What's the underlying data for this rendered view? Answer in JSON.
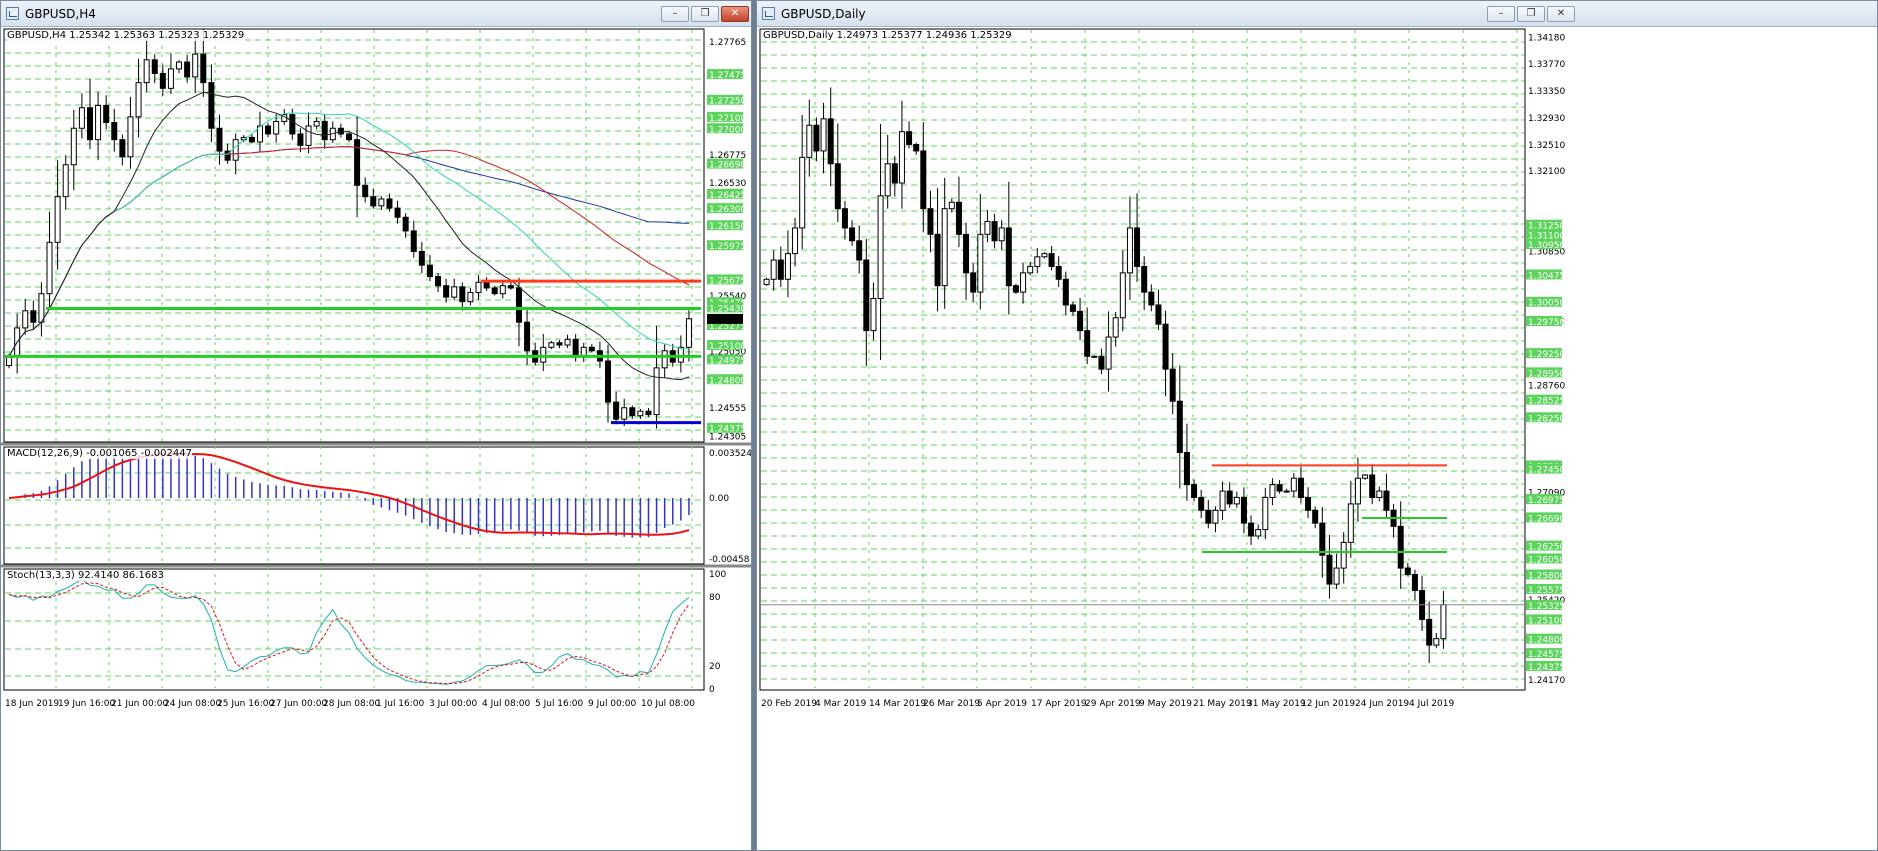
{
  "windowA": {
    "title": "GBPUSD,H4",
    "main_header": "GBPUSD,H4  1.25342 1.25363 1.25323 1.25329",
    "macd_header": "MACD(12,26,9) -0.001065 -0.002447",
    "stoch_header": "Stoch(13,3,3) 92.4140 86.1683",
    "price_labels": [
      "1.27765",
      "1.26775",
      "1.26530",
      "1.25540",
      "1.25050",
      "1.24555",
      "1.24305"
    ],
    "green_price_tags": [
      "1.27475",
      "1.27250",
      "1.27100",
      "1.27000",
      "1.26690",
      "1.26425",
      "1.26300",
      "1.26150",
      "1.25975",
      "1.25675",
      "1.25475",
      "1.25430",
      "1.25325",
      "1.25275",
      "1.25100",
      "1.24975",
      "1.24800",
      "1.24375"
    ],
    "macd_labels": [
      "0.003524",
      "0.00",
      "-0.00458"
    ],
    "stoch_labels": [
      "100",
      "80",
      "20",
      "0"
    ],
    "time_labels": [
      "18 Jun 2019",
      "19 Jun 16:00",
      "21 Jun 00:00",
      "24 Jun 08:00",
      "25 Jun 16:00",
      "27 Jun 00:00",
      "28 Jun 08:00",
      "1 Jul 16:00",
      "3 Jul 00:00",
      "4 Jul 08:00",
      "5 Jul 16:00",
      "9 Jul 00:00",
      "10 Jul 08:00"
    ],
    "controls": {
      "minimize": "–",
      "restore": "❐",
      "close": "✕"
    }
  },
  "windowB": {
    "title": "GBPUSD,Daily",
    "main_header": "GBPUSD,Daily  1.24973 1.25377 1.24936 1.25329",
    "price_labels": [
      "1.34180",
      "1.33770",
      "1.33350",
      "1.32930",
      "1.32510",
      "1.32100",
      "1.30850",
      "1.29760",
      "1.28760",
      "1.27090",
      "1.25420",
      "1.24170"
    ],
    "green_price_tags": [
      "1.31250",
      "1.31100",
      "1.30950",
      "1.30475",
      "1.30050",
      "1.29750",
      "1.29250",
      "1.28950",
      "1.28525",
      "1.28250",
      "1.27500",
      "1.27450",
      "1.26975",
      "1.26690",
      "1.26250",
      "1.26050",
      "1.25800",
      "1.25575",
      "1.25325",
      "1.25100",
      "1.24800",
      "1.24575",
      "1.24375"
    ],
    "time_labels": [
      "20 Feb 2019",
      "4 Mar 2019",
      "14 Mar 2019",
      "26 Mar 2019",
      "5 Apr 2019",
      "17 Apr 2019",
      "29 Apr 2019",
      "9 May 2019",
      "21 May 2019",
      "31 May 2019",
      "12 Jun 2019",
      "24 Jun 2019",
      "4 Jul 2019"
    ],
    "controls": {
      "minimize": "–",
      "restore": "❐",
      "close": "✕"
    }
  },
  "colors": {
    "bull": "#ffffff",
    "bear": "#000000",
    "grid": "#5cd35c",
    "tag": "#5cd35c",
    "red_line": "#ff3b1a",
    "green_line": "#22cc22",
    "blue_line": "#0000cc",
    "macd_hist": "#3333cc",
    "macd_signal": "#ee1111",
    "stoch_main": "#20b2aa",
    "stoch_signal": "#e11111",
    "ma_blue": "#2233aa",
    "ma_red": "#cc2222",
    "ma_teal": "#30d6b0",
    "ma_black": "#222222"
  },
  "chart_data": [
    {
      "type": "candlestick",
      "title": "GBPUSD,H4",
      "ylim": [
        1.2425,
        1.2787
      ],
      "last_price": 1.25329,
      "horizontal_levels": [
        {
          "price": 1.2566,
          "color": "red"
        },
        {
          "price": 1.2542,
          "color": "green"
        },
        {
          "price": 1.25,
          "color": "green"
        },
        {
          "price": 1.2442,
          "color": "blue"
        }
      ],
      "close": [
        1.25,
        1.2525,
        1.254,
        1.253,
        1.2555,
        1.26,
        1.264,
        1.2668,
        1.27,
        1.2718,
        1.269,
        1.272,
        1.2705,
        1.269,
        1.2675,
        1.271,
        1.274,
        1.276,
        1.2748,
        1.2735,
        1.2752,
        1.2758,
        1.2745,
        1.2765,
        1.274,
        1.27,
        1.268,
        1.2672,
        1.269,
        1.2692,
        1.2688,
        1.2702,
        1.2695,
        1.2706,
        1.2712,
        1.2695,
        1.2685,
        1.2702,
        1.2706,
        1.269,
        1.27,
        1.2695,
        1.269,
        1.265,
        1.264,
        1.2632,
        1.2638,
        1.263,
        1.2622,
        1.261,
        1.2592,
        1.258,
        1.257,
        1.2562,
        1.2552,
        1.2561,
        1.2548,
        1.2556,
        1.2565,
        1.256,
        1.2555,
        1.2562,
        1.256,
        1.253,
        1.2505,
        1.2495,
        1.2508,
        1.2512,
        1.251,
        1.2515,
        1.25,
        1.2508,
        1.2505,
        1.2496,
        1.246,
        1.2445,
        1.2455,
        1.2448,
        1.2452,
        1.2449,
        1.249,
        1.2505,
        1.2495,
        1.2508,
        1.2533
      ],
      "macd_hist_range": [
        -0.00458,
        0.003524
      ],
      "stoch_range": [
        0,
        100
      ],
      "stoch_main_last": 92.414,
      "stoch_signal_last": 86.1683
    },
    {
      "type": "candlestick",
      "title": "GBPUSD,Daily",
      "ylim": [
        1.24,
        1.343
      ],
      "last_price": 1.25329,
      "horizontal_levels": [
        {
          "price": 1.275,
          "color": "red"
        },
        {
          "price": 1.2668,
          "color": "green"
        },
        {
          "price": 1.2615,
          "color": "green"
        }
      ],
      "close": [
        1.304,
        1.307,
        1.304,
        1.308,
        1.312,
        1.323,
        1.328,
        1.324,
        1.329,
        1.322,
        1.315,
        1.312,
        1.31,
        1.307,
        1.296,
        1.301,
        1.317,
        1.322,
        1.319,
        1.327,
        1.325,
        1.324,
        1.315,
        1.311,
        1.303,
        1.315,
        1.316,
        1.311,
        1.305,
        1.302,
        1.311,
        1.313,
        1.31,
        1.312,
        1.303,
        1.302,
        1.305,
        1.306,
        1.3075,
        1.308,
        1.306,
        1.304,
        1.3,
        1.299,
        1.296,
        1.292,
        1.292,
        1.29,
        1.295,
        1.298,
        1.305,
        1.312,
        1.306,
        1.302,
        1.3,
        1.297,
        1.29,
        1.285,
        1.277,
        1.272,
        1.27,
        1.268,
        1.266,
        1.268,
        1.271,
        1.269,
        1.27,
        1.266,
        1.264,
        1.265,
        1.27,
        1.272,
        1.271,
        1.271,
        1.273,
        1.27,
        1.268,
        1.266,
        1.261,
        1.2565,
        1.259,
        1.263,
        1.269,
        1.273,
        1.2735,
        1.27,
        1.271,
        1.268,
        1.2655,
        1.259,
        1.258,
        1.2555,
        1.251,
        1.247,
        1.248,
        1.2533
      ]
    }
  ]
}
